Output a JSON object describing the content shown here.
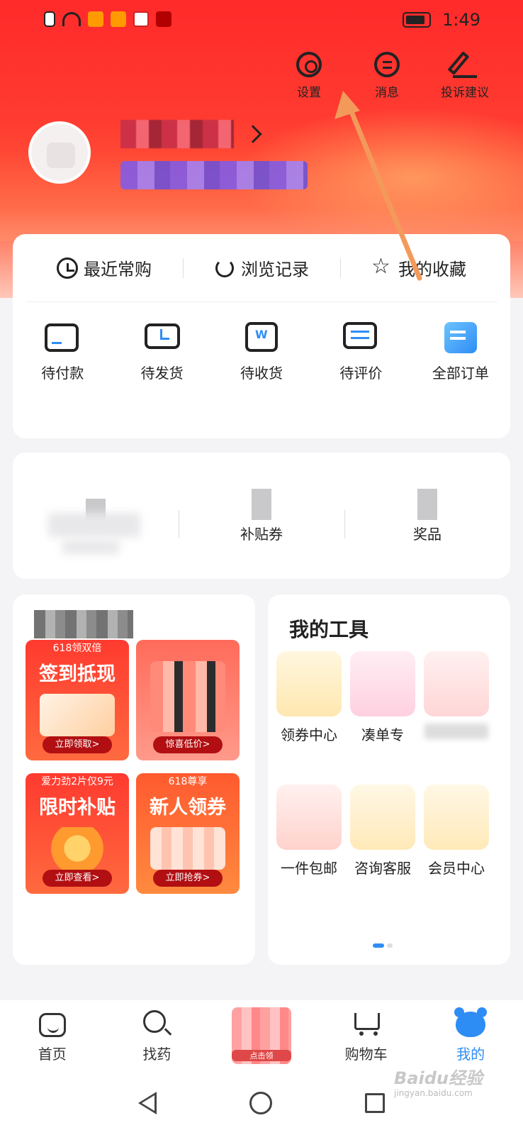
{
  "status_bar": {
    "time": "1:49"
  },
  "top_actions": [
    {
      "label": "设置",
      "icon": "gear-icon"
    },
    {
      "label": "消息",
      "icon": "message-icon"
    },
    {
      "label": "投诉建议",
      "icon": "pen-icon"
    }
  ],
  "shortcuts": [
    {
      "label": "最近常购",
      "icon": "clock-icon"
    },
    {
      "label": "浏览记录",
      "icon": "history-icon"
    },
    {
      "label": "我的收藏",
      "icon": "star-icon"
    }
  ],
  "orders": [
    {
      "label": "待付款",
      "icon": "card-icon"
    },
    {
      "label": "待发货",
      "icon": "truck-icon"
    },
    {
      "label": "待收货",
      "icon": "box-icon"
    },
    {
      "label": "待评价",
      "icon": "review-icon"
    },
    {
      "label": "全部订单",
      "icon": "all-orders-icon"
    }
  ],
  "wallet": [
    {
      "label": "",
      "sub": ""
    },
    {
      "label": "补贴券",
      "sub": ""
    },
    {
      "label": "奖品",
      "sub": ""
    }
  ],
  "promos": [
    {
      "top": "618领双倍",
      "main": "签到抵现",
      "button": "立即领取>"
    },
    {
      "top": "",
      "main": "",
      "button": "惊喜低价>"
    },
    {
      "top": "爱力劲2片仅9元",
      "main": "限时补贴",
      "button": "立即查看>"
    },
    {
      "top": "618尊享",
      "main": "新人领券",
      "button": "立即抢券>"
    }
  ],
  "tools": {
    "title": "我的工具",
    "items": [
      {
        "label": "领券中心",
        "icon": "coupon-icon"
      },
      {
        "label": "凑单专",
        "icon": "alarm-icon"
      },
      {
        "label": "",
        "icon": "gift-icon"
      },
      {
        "label": "一件包邮",
        "icon": "bag-icon"
      },
      {
        "label": "咨询客服",
        "icon": "headset-icon"
      },
      {
        "label": "会员中心",
        "icon": "crown-icon"
      }
    ]
  },
  "tab_bar": [
    {
      "label": "首页",
      "icon": "home-icon",
      "active": false
    },
    {
      "label": "找药",
      "icon": "search-icon",
      "active": false
    },
    {
      "label": "",
      "icon": "center-promo",
      "active": false
    },
    {
      "label": "购物车",
      "icon": "cart-icon",
      "active": false
    },
    {
      "label": "我的",
      "icon": "bear-icon",
      "active": true
    }
  ],
  "center_promo_text": "点击领",
  "watermark": {
    "main": "Baidu经验",
    "sub": "jingyan.baidu.com"
  },
  "colors": {
    "accent": "#2e8df5",
    "hero_red": "#ff3b30",
    "annotation_arrow": "#f39a5b"
  }
}
